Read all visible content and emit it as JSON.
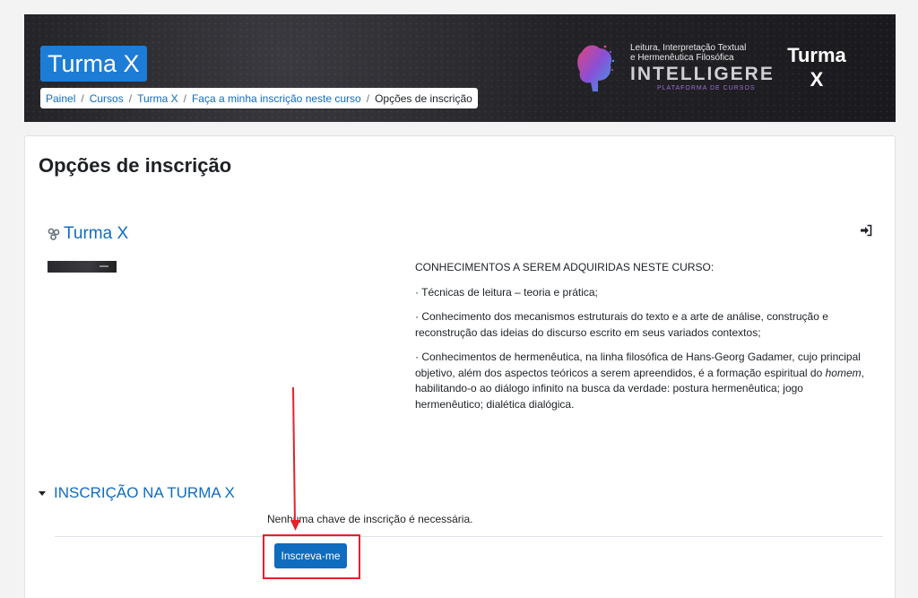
{
  "header": {
    "course_title": "Turma X",
    "breadcrumb": [
      "Painel",
      "Cursos",
      "Turma X",
      "Faça a minha inscrição neste curso",
      "Opções de inscrição"
    ],
    "brand": {
      "line1": "Leitura, Interpretação Textual",
      "line2": "e Hermenêutica Filosófica",
      "name": "INTELLIGERE",
      "sub": "PLATAFORMA DE CURSOS",
      "turma_line1": "Turma",
      "turma_line2": "X"
    }
  },
  "main": {
    "page_title": "Opções de inscrição",
    "course_link": "Turma X",
    "summary": [
      "CONHECIMENTOS A SEREM ADQUIRIDAS NESTE CURSO:",
      "· Técnicas de leitura – teoria e prática;",
      "· Conhecimento dos mecanismos estruturais do texto e a arte de análise, construção e reconstrução das ideias do discurso escrito em seus variados contextos;",
      "· Conhecimentos de hermenêutica, na linha filosófica de Hans-Georg Gadamer, cujo principal objetivo, além dos aspectos teóricos a serem apreendidos, é a formação espiritual do ",
      "homem",
      ", habilitando-o ao diálogo infinito na busca da verdade: postura hermenêutica; jogo hermenêutico; dialética dialógica."
    ],
    "enrolment": {
      "section_title": "INSCRIÇÃO NA TURMA X",
      "key_note": "Nenhuma chave de inscrição é necessária.",
      "button_label": "Inscreva-me"
    }
  },
  "colors": {
    "primary": "#0f6cbf",
    "highlight": "#e8202a"
  }
}
